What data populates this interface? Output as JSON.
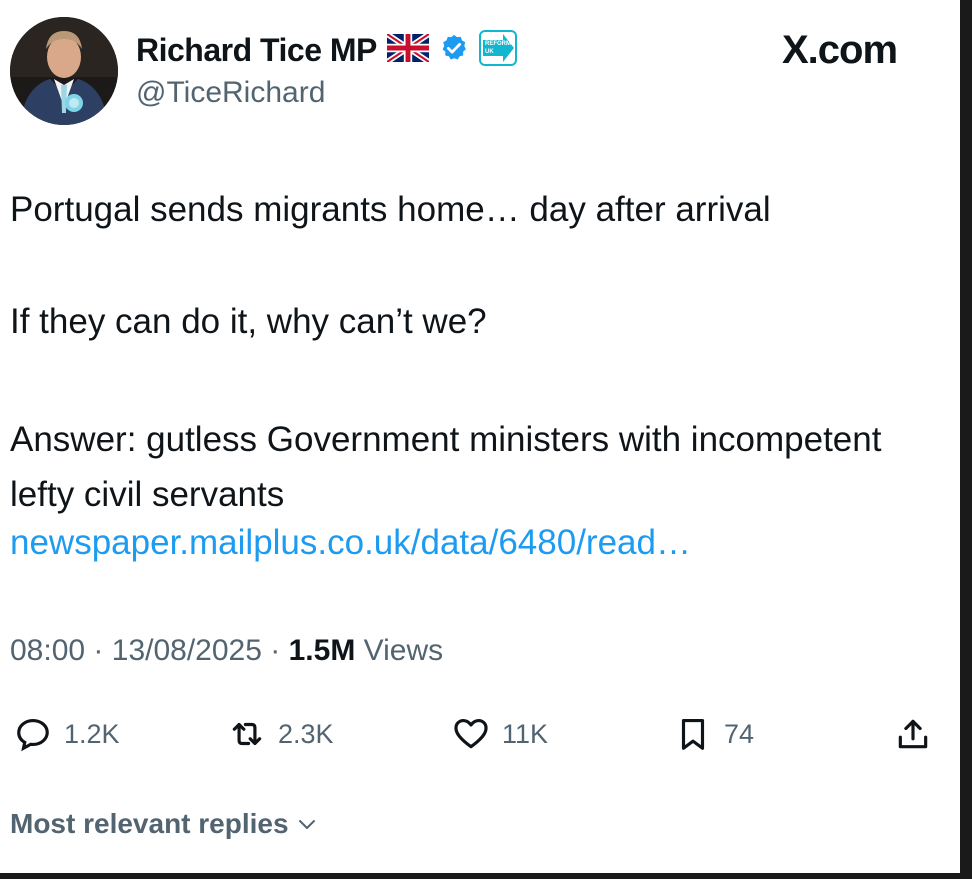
{
  "author": {
    "display_name": "Richard Tice MP",
    "handle": "@TiceRichard",
    "flag_icon": "uk-flag-icon",
    "verified_icon": "verified-badge-icon",
    "affiliate_badge_text": "REFORM UK"
  },
  "site_label": "X.com",
  "tweet": {
    "line1": "Portugal sends migrants home… day after arrival",
    "line2": "If they can do it, why can’t we?",
    "line3": "Answer: gutless Government ministers with incompetent lefty civil servants",
    "link_text": "newspaper.mailplus.co.uk/data/6480/read…"
  },
  "meta": {
    "time": "08:00",
    "separator": "·",
    "date": "13/08/2025",
    "views_count": "1.5M",
    "views_label": "Views"
  },
  "actions": {
    "replies": "1.2K",
    "reposts": "2.3K",
    "likes": "11K",
    "bookmarks": "74"
  },
  "replies_section": {
    "label": "Most relevant replies"
  },
  "colors": {
    "link": "#1d9bf0",
    "secondary_text": "#536471",
    "verified": "#1d9bf0",
    "reform_badge": "#12b6cf"
  }
}
